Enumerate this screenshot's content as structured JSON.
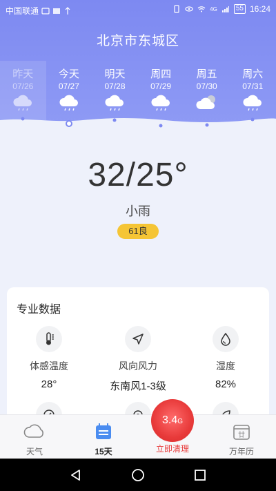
{
  "statusbar": {
    "carrier": "中国联通",
    "battery": "55",
    "time": "16:24",
    "network": "4G"
  },
  "city": "北京市东城区",
  "days": [
    {
      "name": "昨天",
      "date": "07/26",
      "icon": "rain-cloud-icon"
    },
    {
      "name": "今天",
      "date": "07/27",
      "icon": "rain-cloud-icon"
    },
    {
      "name": "明天",
      "date": "07/28",
      "icon": "rain-cloud-icon"
    },
    {
      "name": "周四",
      "date": "07/29",
      "icon": "rain-cloud-icon"
    },
    {
      "name": "周五",
      "date": "07/30",
      "icon": "overcast-cloud-icon"
    },
    {
      "name": "周六",
      "date": "07/31",
      "icon": "rain-cloud-icon"
    }
  ],
  "current": {
    "temp": "32/25°",
    "condition": "小雨",
    "aqi": "61良"
  },
  "pro": {
    "title": "专业数据",
    "metrics": [
      {
        "label": "体感温度",
        "value": "28°",
        "icon": "thermometer-icon"
      },
      {
        "label": "风向风力",
        "value": "东南风1-3级",
        "icon": "navigation-arrow-icon"
      },
      {
        "label": "湿度",
        "value": "82%",
        "icon": "water-drop-icon"
      }
    ]
  },
  "tabs": {
    "weather": "天气",
    "fifteen": "15天",
    "clean": "立即清理",
    "calendar": "万年历",
    "calendar_icon_text": "廿"
  },
  "clean_size": {
    "value": "3.4",
    "unit": "G"
  },
  "colors": {
    "header": "#7d89f1",
    "aqi": "#f5c535",
    "clean": "#e83a3a",
    "active_tab": "#4a8cf0"
  }
}
